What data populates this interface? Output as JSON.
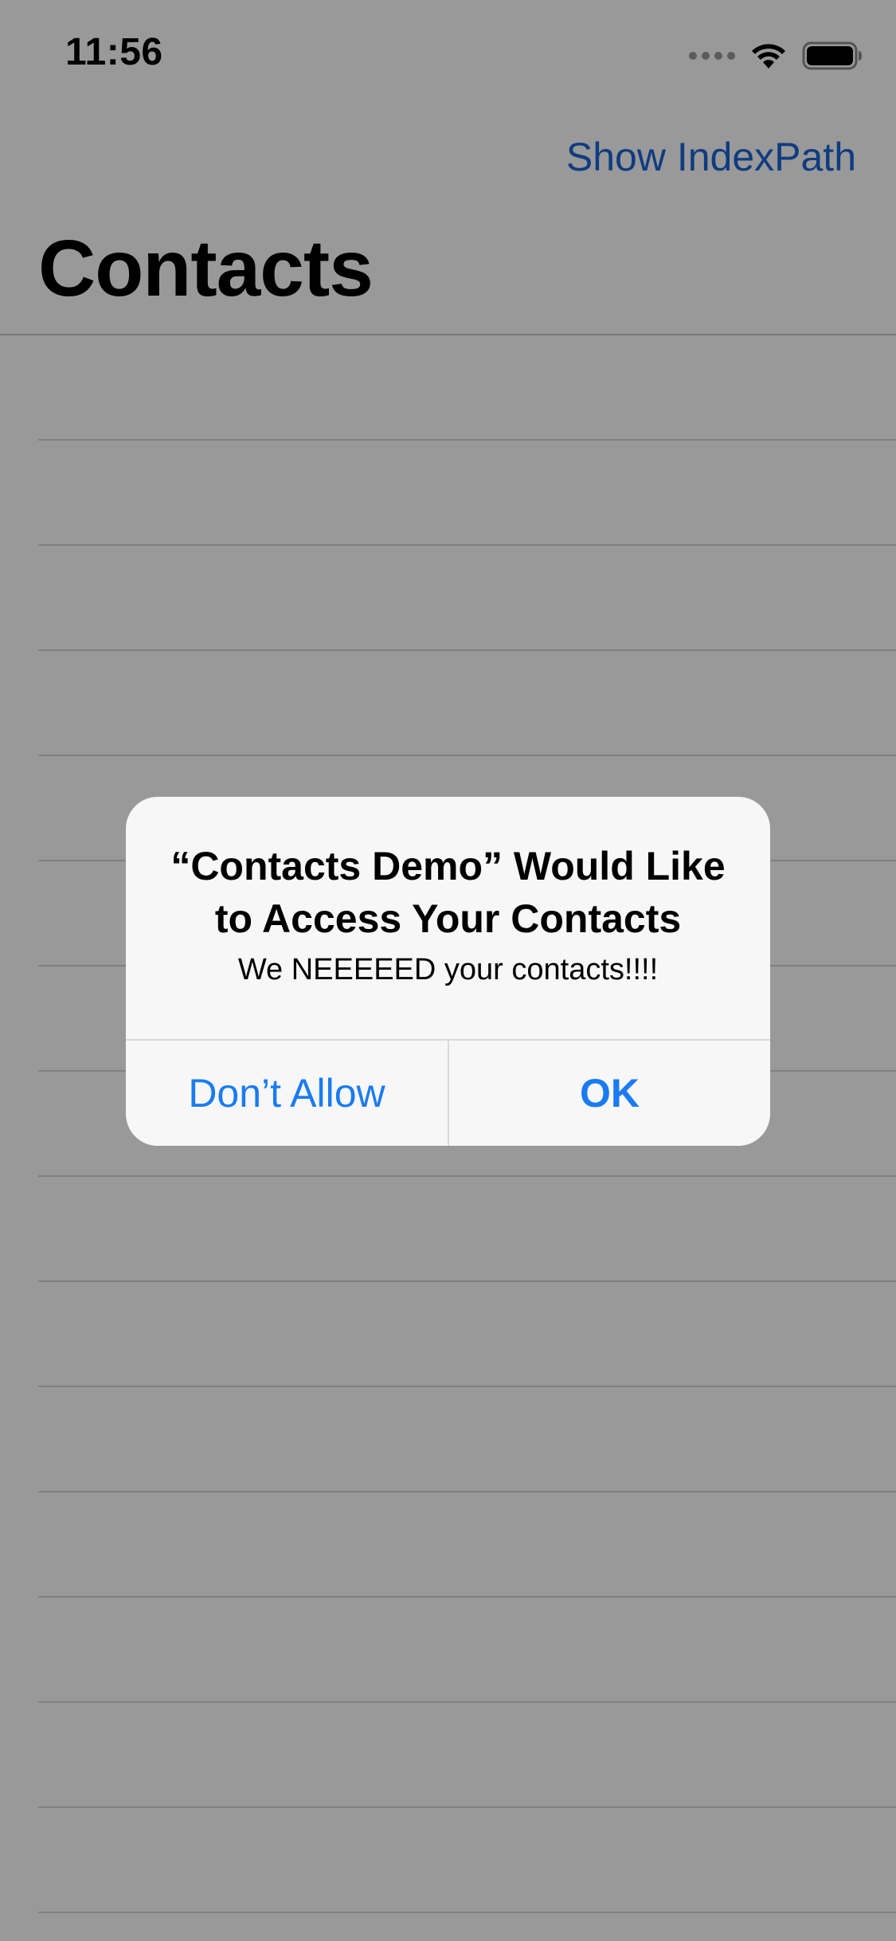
{
  "status_bar": {
    "time": "11:56"
  },
  "nav": {
    "right_button": "Show IndexPath",
    "title": "Contacts"
  },
  "table": {
    "row_count": 15
  },
  "alert": {
    "title": "“Contacts Demo” Would Like to Access Your Contacts",
    "message": "We NEEEEED your contacts!!!!",
    "buttons": {
      "deny": "Don’t Allow",
      "ok": "OK"
    }
  },
  "colors": {
    "accent": "#1a7bf2",
    "nav_link": "#1a64d6",
    "dim_overlay": "rgba(0,0,0,0.40)",
    "alert_background": "#f7f7f7"
  },
  "icons": [
    "signal-icon",
    "wifi-icon",
    "battery-icon"
  ]
}
